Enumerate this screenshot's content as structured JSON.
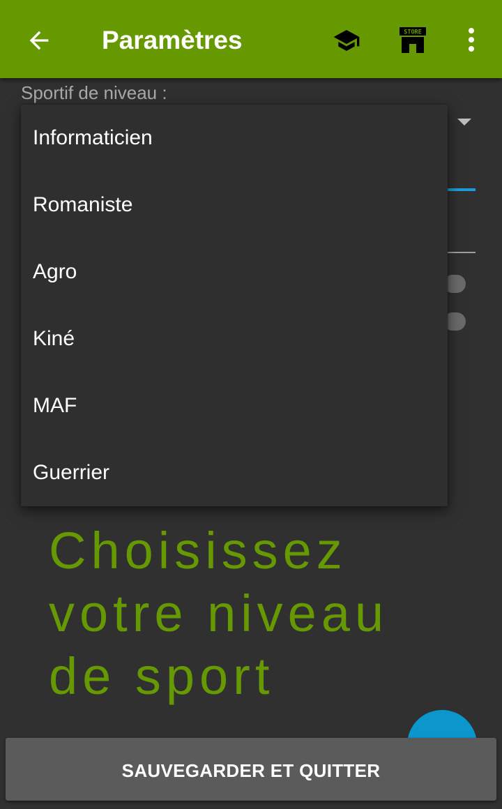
{
  "appbar": {
    "title": "Paramètres",
    "icons": [
      "arrow-left-icon",
      "graduation-cap-icon",
      "store-icon",
      "more-vert-icon"
    ],
    "store_badge_text": "STORE",
    "color": "#669900"
  },
  "settings": {
    "level_label": "Sportif de niveau :"
  },
  "dropdown": {
    "options": [
      "Informaticien",
      "Romaniste",
      "Agro",
      "Kiné",
      "MAF",
      "Guerrier"
    ]
  },
  "promo": {
    "line1": "Choisissez",
    "line2": "votre niveau",
    "line3": "de sport"
  },
  "footer": {
    "save_label": "SAUVEGARDER ET QUITTER"
  },
  "colors": {
    "accent": "#669900",
    "background": "#303030",
    "fab": "#0b96cc",
    "underline": "#1e9bd2"
  }
}
